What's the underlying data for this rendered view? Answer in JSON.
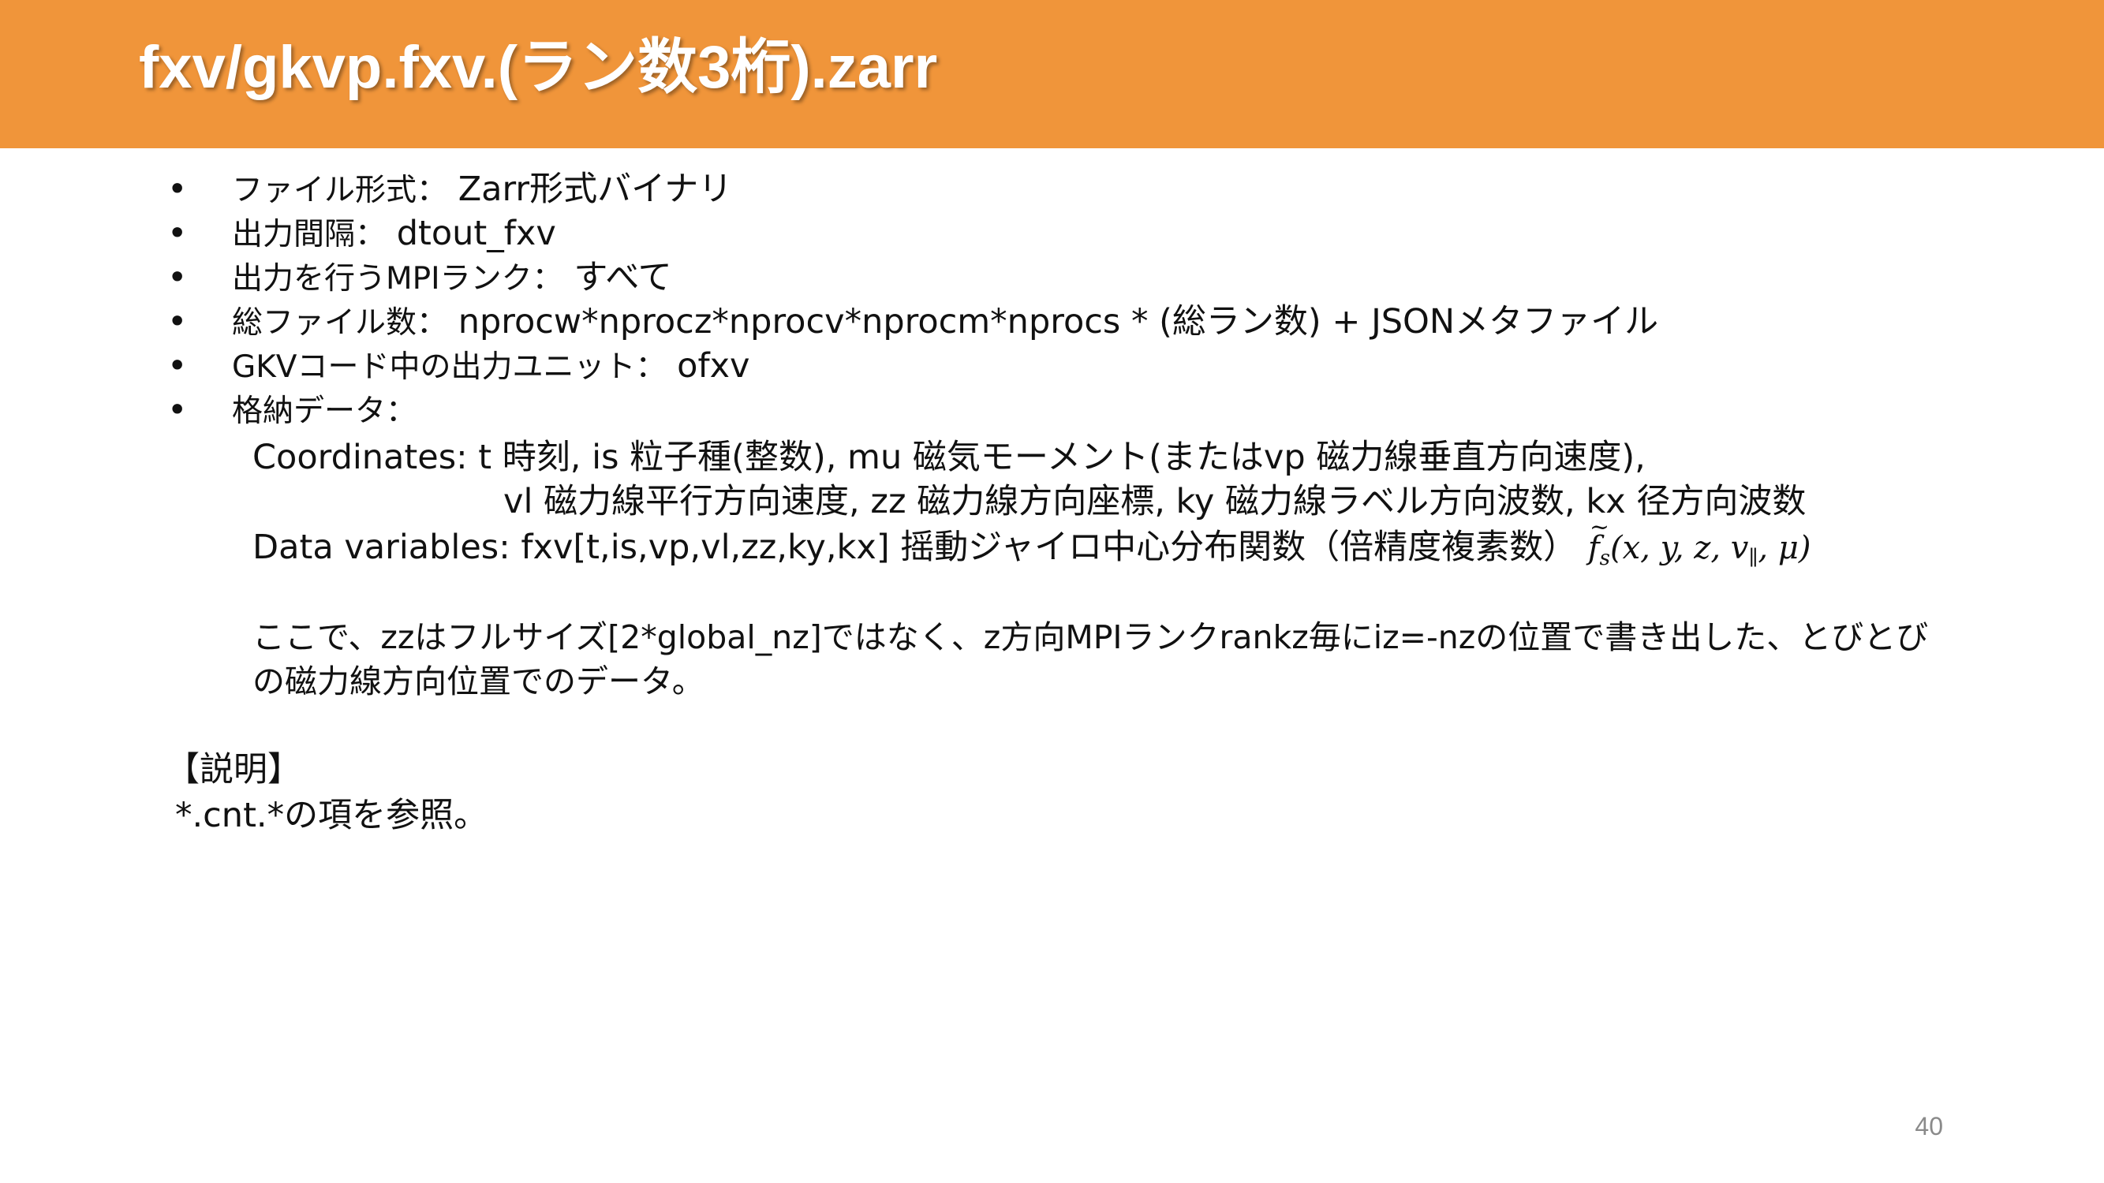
{
  "slide": {
    "title": "fxv/gkvp.fxv.(ラン数3桁).zarr",
    "page_number": "40"
  },
  "bullets": [
    {
      "marker": "•",
      "label": "ファイル形式：",
      "value": "Zarr形式バイナリ"
    },
    {
      "marker": "•",
      "label": "出力間隔：",
      "value": "dtout_fxv"
    },
    {
      "marker": "•",
      "label": "出力を行うMPIランク：",
      "value": "すべて"
    },
    {
      "marker": "•",
      "label": "総ファイル数：",
      "value": "nprocw*nprocz*nprocv*nprocm*nprocs * (総ラン数) + JSONメタファイル"
    },
    {
      "marker": "•",
      "label": "GKVコード中の出力ユニット：",
      "value": "ofxv"
    },
    {
      "marker": "•",
      "label": "格納データ：",
      "value": ""
    }
  ],
  "stored_data": {
    "coordinates_line1": "Coordinates: t 時刻, is 粒子種(整数), mu 磁気モーメント(またはvp 磁力線垂直方向速度),",
    "coordinates_line2": "vl 磁力線平行方向速度, zz 磁力線方向座標, ky 磁力線ラベル方向波数, kx 径方向波数",
    "data_variables": "Data variables: fxv[t,is,vp,vl,zz,ky,kx] 摇動ジャイロ中心分布関数（倍精度複素数）",
    "formula_f": "f",
    "formula_sub": "s",
    "formula_args_open": "(x, y, z, v",
    "formula_par": "∥",
    "formula_args_close": ", μ)",
    "note_line1": "ここで、zzはフルサイズ[2*global_nz]ではなく、z方向MPIランクrankz毎にiz=-nzの位置で書き出した、とびとび",
    "note_line2": "の磁力線方向位置でのデータ。"
  },
  "explanation": {
    "heading": "【説明】",
    "text": "*.cnt.*の項を参照。"
  },
  "colors": {
    "title_bar": "#f0953a",
    "title_text": "#ffffff",
    "body_text": "#111111",
    "page_number": "#8a8a8a"
  }
}
